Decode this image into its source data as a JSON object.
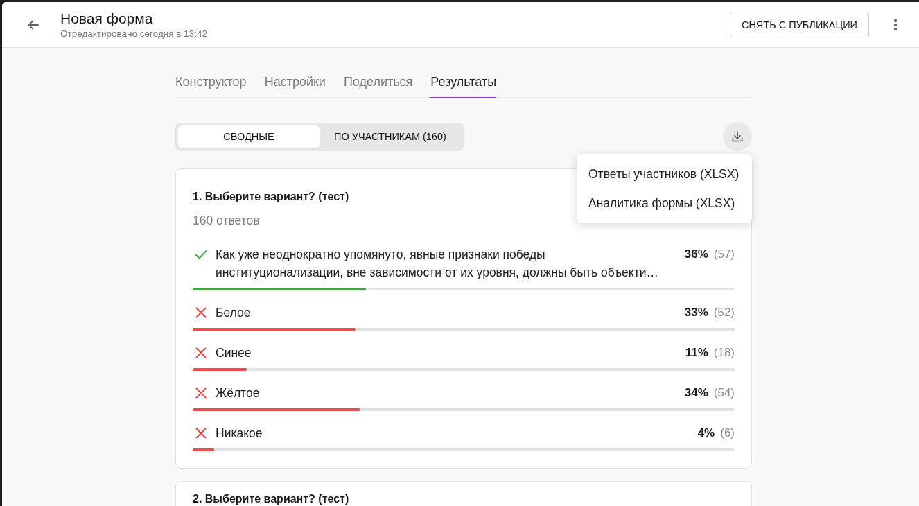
{
  "header": {
    "title": "Новая форма",
    "subtitle": "Отредактировано сегодня в 13:42",
    "action": "СНЯТЬ С ПУБЛИКАЦИИ"
  },
  "tabs": [
    {
      "label": "Конструктор",
      "selected": false
    },
    {
      "label": "Настройки",
      "selected": false
    },
    {
      "label": "Поделиться",
      "selected": false
    },
    {
      "label": "Результаты",
      "selected": true
    }
  ],
  "view_switch": [
    {
      "label": "СВОДНЫЕ",
      "selected": true
    },
    {
      "label": "ПО УЧАСТНИКАМ (160)",
      "selected": false
    }
  ],
  "export": {
    "expanded": true,
    "items": [
      "Ответы участников (XLSX)",
      "Аналитика формы (XLSX)"
    ]
  },
  "questions": [
    {
      "title": "1. Выберите вариант? (тест)",
      "count": "160 ответов",
      "options": [
        {
          "label": "Как уже неоднократно упомянуто, явные признаки победы институционализации, вне зависимости от их уровня, должны быть объекти…",
          "correct": true,
          "percent": "36%",
          "answers": "(57)",
          "level": 0.32
        },
        {
          "label": "Белое",
          "correct": false,
          "percent": "33%",
          "answers": "(52)",
          "level": 0.3
        },
        {
          "label": "Синее",
          "correct": false,
          "percent": "11%",
          "answers": "(18)",
          "level": 0.1
        },
        {
          "label": "Жёлтое",
          "correct": false,
          "percent": "34%",
          "answers": "(54)",
          "level": 0.31
        },
        {
          "label": "Никакое",
          "correct": false,
          "percent": "4%",
          "answers": "(6)",
          "level": 0.04
        }
      ]
    },
    {
      "title": "2. Выберите вариант? (тест)"
    }
  ]
}
